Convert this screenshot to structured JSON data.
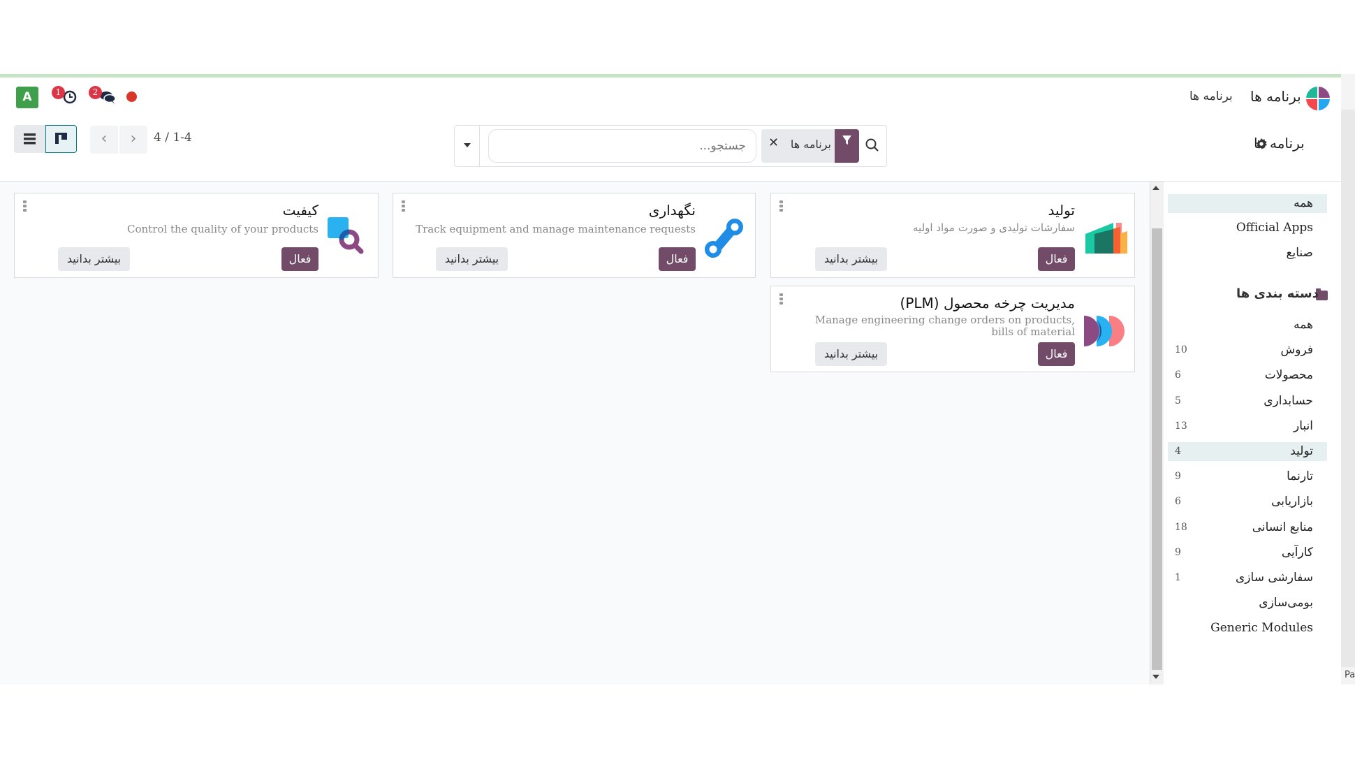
{
  "navbar": {
    "app_title": "برنامه ها",
    "menu_item": "برنامه ها",
    "avatar_letter": "A",
    "activity_count": "1",
    "messages_count": "2",
    "brand_color": "#714b67"
  },
  "control_panel": {
    "breadcrumb": "برنامه ها",
    "search": {
      "placeholder": "جستجو...",
      "value": "",
      "facet_label": "برنامه ها"
    },
    "pager": {
      "value": "4 / 1-4"
    },
    "views": [
      "list",
      "kanban"
    ],
    "active_view": "kanban"
  },
  "apps": [
    {
      "name": "تولید",
      "description": "سفارشات تولیدی و صورت مواد اولیه",
      "icon": "manufacturing-icon",
      "status_label": "فعال",
      "learn_more_label": "بیشتر بدانید"
    },
    {
      "name": "نگهداری",
      "description": "Track equipment and manage maintenance requests",
      "icon": "maintenance-icon",
      "status_label": "فعال",
      "learn_more_label": "بیشتر بدانید"
    },
    {
      "name": "کیفیت",
      "description": "Control the quality of your products",
      "icon": "quality-icon",
      "status_label": "فعال",
      "learn_more_label": "بیشتر بدانید"
    },
    {
      "name": "مدیریت چرخه محصول (PLM)",
      "description": "Manage engineering change orders on products, bills of material",
      "icon": "plm-icon",
      "status_label": "فعال",
      "learn_more_label": "بیشتر بدانید"
    }
  ],
  "sidebar": {
    "filters": [
      {
        "label": "همه",
        "active": true
      },
      {
        "label": "Official Apps",
        "active": false
      },
      {
        "label": "صنایع",
        "active": false
      }
    ],
    "categories_header": "دسته بندی ها",
    "categories": [
      {
        "label": "همه",
        "count": "",
        "active": false
      },
      {
        "label": "فروش",
        "count": "10",
        "active": false
      },
      {
        "label": "محصولات",
        "count": "6",
        "active": false
      },
      {
        "label": "حسابداری",
        "count": "5",
        "active": false
      },
      {
        "label": "انبار",
        "count": "13",
        "active": false
      },
      {
        "label": "تولید",
        "count": "4",
        "active": true
      },
      {
        "label": "تارنما",
        "count": "9",
        "active": false
      },
      {
        "label": "بازاریابی",
        "count": "6",
        "active": false
      },
      {
        "label": "منابع انسانی",
        "count": "18",
        "active": false
      },
      {
        "label": "کارآیی",
        "count": "9",
        "active": false
      },
      {
        "label": "سفارشی سازی",
        "count": "1",
        "active": false
      },
      {
        "label": "بومی‌سازی",
        "count": "",
        "active": false
      },
      {
        "label": "Generic Modules",
        "count": "",
        "active": false
      }
    ]
  },
  "side_tab": "Pa"
}
